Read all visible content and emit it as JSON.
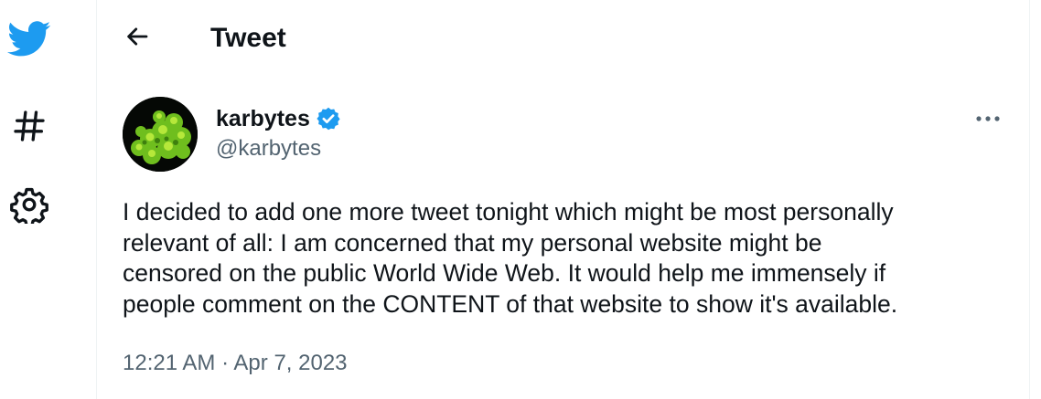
{
  "colors": {
    "brand": "#1d9bf0",
    "text_primary": "#0f1419",
    "text_secondary": "#536471",
    "border": "#eff3f4",
    "verified": "#1d9bf0"
  },
  "sidebar": {
    "items": [
      {
        "icon": "twitter-bird-icon"
      },
      {
        "icon": "hashtag-icon"
      },
      {
        "icon": "gear-icon"
      }
    ]
  },
  "header": {
    "back_icon": "arrow-left-icon",
    "title": "Tweet"
  },
  "tweet": {
    "author": {
      "display_name": "karbytes",
      "handle": "@karbytes",
      "verified_icon": "verified-badge-icon",
      "avatar_icon": "avatar"
    },
    "more_icon": "more-options-icon",
    "text_lines": [
      "I decided to add one more tweet tonight which might be most personally",
      "relevant of all: I am concerned that my personal website might be",
      "censored on the public World Wide Web. It would help me immensely if",
      "people comment on the CONTENT of that website to show it's available."
    ],
    "time": "12:21 AM",
    "separator": "·",
    "date": "Apr 7, 2023"
  }
}
